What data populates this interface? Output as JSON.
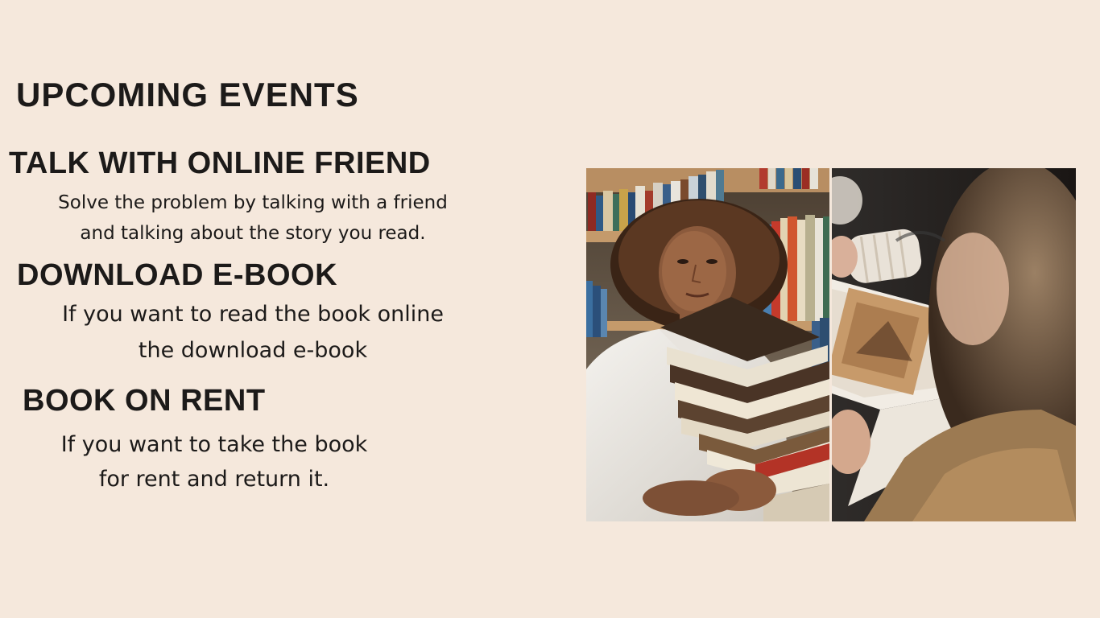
{
  "page_title": "UPCOMING EVENTS",
  "events": [
    {
      "title": "TALK WITH ONLINE FRIEND",
      "lines": [
        "Solve the problem by talking with a friend",
        "and talking about the story you read."
      ]
    },
    {
      "title": "DOWNLOAD E-BOOK",
      "lines": [
        "If you want to read the book online",
        "the download e-book"
      ]
    },
    {
      "title": "BOOK ON RENT",
      "lines": [
        "If you want to take the book",
        "for rent and return it."
      ]
    }
  ],
  "colors": {
    "background": "#f5e8dc",
    "text": "#1c1a19"
  }
}
